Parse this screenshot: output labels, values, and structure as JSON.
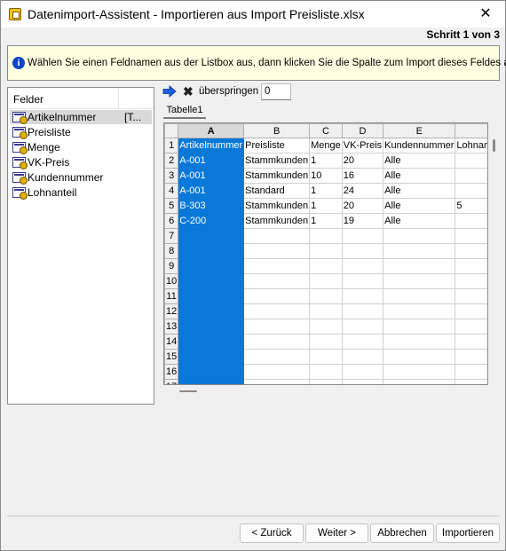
{
  "window": {
    "title": "Datenimport-Assistent -  Importieren aus  Import Preisliste.xlsx",
    "step": "Schritt 1 von 3"
  },
  "info": {
    "text": "Wählen Sie einen Feldnamen aus der Listbox aus, dann klicken Sie die Spalte zum Import dieses Feldes an."
  },
  "fields": {
    "header": "Felder",
    "items": [
      {
        "label": "Artikelnummer",
        "extra": "[T..."
      },
      {
        "label": "Preisliste",
        "extra": ""
      },
      {
        "label": "Menge",
        "extra": ""
      },
      {
        "label": "VK-Preis",
        "extra": ""
      },
      {
        "label": "Kundennummer",
        "extra": ""
      },
      {
        "label": "Lohnanteil",
        "extra": ""
      }
    ]
  },
  "toolbar": {
    "skip_label": "überspringen",
    "skip_value": "0"
  },
  "sheet": {
    "tab": "Tabelle1",
    "columns": [
      "A",
      "B",
      "C",
      "D",
      "E",
      ""
    ],
    "rows": [
      {
        "n": "1",
        "cells": [
          "Artikelnummer",
          "Preisliste",
          "Menge",
          "VK-Preis",
          "Kundennummer",
          "Lohnanteil"
        ]
      },
      {
        "n": "2",
        "cells": [
          "A-001",
          "Stammkunden",
          "1",
          "20",
          "Alle",
          ""
        ]
      },
      {
        "n": "3",
        "cells": [
          "A-001",
          "Stammkunden",
          "10",
          "16",
          "Alle",
          ""
        ]
      },
      {
        "n": "4",
        "cells": [
          "A-001",
          "Standard",
          "1",
          "24",
          "Alle",
          ""
        ]
      },
      {
        "n": "5",
        "cells": [
          "B-303",
          "Stammkunden",
          "1",
          "20",
          "Alle",
          "5"
        ]
      },
      {
        "n": "6",
        "cells": [
          "C-200",
          "Stammkunden",
          "1",
          "19",
          "Alle",
          ""
        ]
      },
      {
        "n": "7",
        "cells": [
          "",
          "",
          "",
          "",
          "",
          ""
        ]
      },
      {
        "n": "8",
        "cells": [
          "",
          "",
          "",
          "",
          "",
          ""
        ]
      },
      {
        "n": "9",
        "cells": [
          "",
          "",
          "",
          "",
          "",
          ""
        ]
      },
      {
        "n": "10",
        "cells": [
          "",
          "",
          "",
          "",
          "",
          ""
        ]
      },
      {
        "n": "11",
        "cells": [
          "",
          "",
          "",
          "",
          "",
          ""
        ]
      },
      {
        "n": "12",
        "cells": [
          "",
          "",
          "",
          "",
          "",
          ""
        ]
      },
      {
        "n": "13",
        "cells": [
          "",
          "",
          "",
          "",
          "",
          ""
        ]
      },
      {
        "n": "14",
        "cells": [
          "",
          "",
          "",
          "",
          "",
          ""
        ]
      },
      {
        "n": "15",
        "cells": [
          "",
          "",
          "",
          "",
          "",
          ""
        ]
      },
      {
        "n": "16",
        "cells": [
          "",
          "",
          "",
          "",
          "",
          ""
        ]
      },
      {
        "n": "17",
        "cells": [
          "",
          "",
          "",
          "",
          "",
          ""
        ]
      }
    ]
  },
  "buttons": {
    "back": "< Zurück",
    "next": "Weiter >",
    "cancel": "Abbrechen",
    "import": "Importieren"
  },
  "colors": {
    "selected_column": "#0a78d7",
    "info_background": "#ffffe1"
  }
}
